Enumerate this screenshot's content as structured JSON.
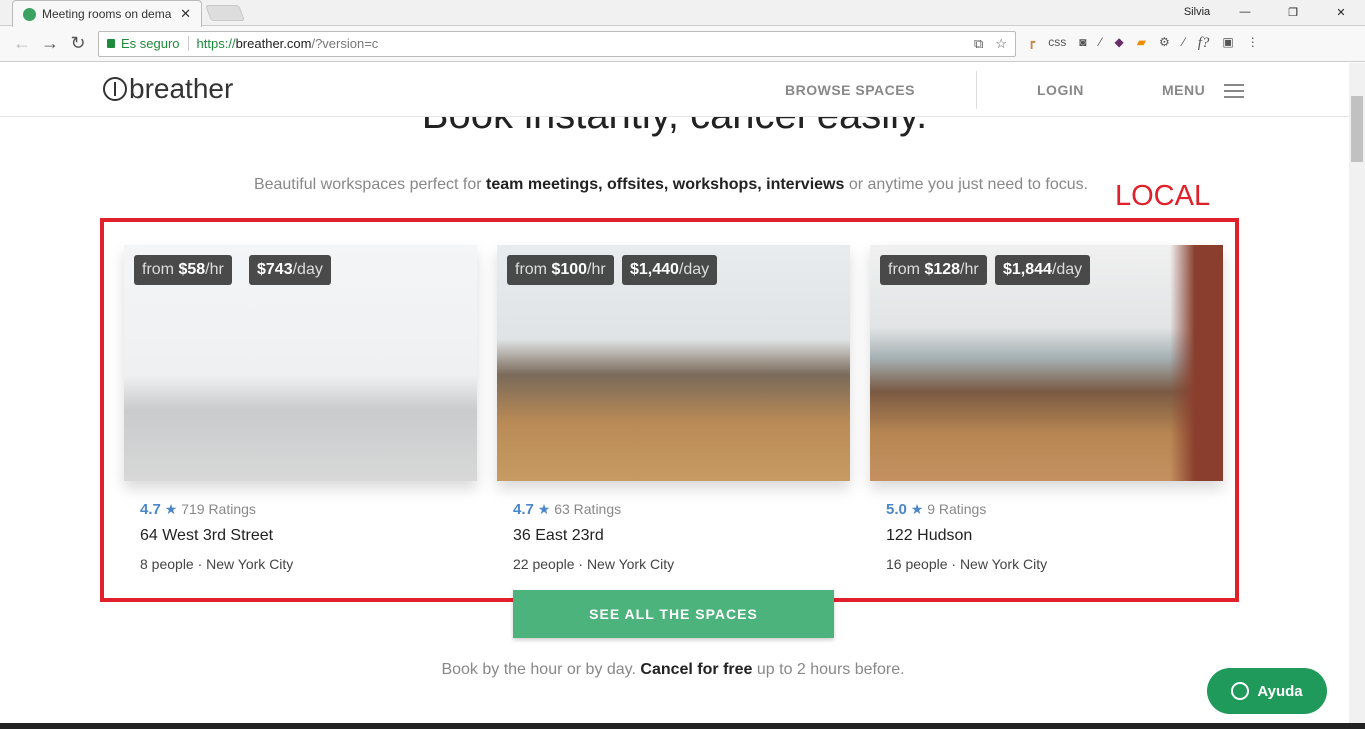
{
  "browser": {
    "tab_title": "Meeting rooms on dema",
    "user": "Silvia",
    "secure_label": "Es seguro",
    "url_scheme": "https://",
    "url_host": "breather.com",
    "url_path": "/?version=c",
    "extensions": [
      "ruler-icon",
      "css",
      "camera-icon",
      "eyedropper-icon",
      "layers-icon",
      "tag-icon",
      "gear-icon",
      "eyedropper-icon",
      "f?",
      "bulb-icon"
    ]
  },
  "header": {
    "logo": "breather",
    "browse": "BROWSE SPACES",
    "login": "LOGIN",
    "menu": "MENU"
  },
  "hero": {
    "title": "Book instantly, cancel easily.",
    "sub_pre": "Beautiful workspaces perfect for ",
    "sub_bold": "team meetings, offsites, workshops, interviews",
    "sub_post": " or anytime you just need to focus."
  },
  "annotation": {
    "label": "LOCAL",
    "color": "#e0202b"
  },
  "cards": [
    {
      "hr_from": "from ",
      "hr_price": "$58",
      "hr_unit": "/hr",
      "day_price": "$743",
      "day_unit": "/day",
      "rating": "4.7",
      "ratings": "719 Ratings",
      "name": "64 West 3rd Street",
      "info": "8 people · New York City"
    },
    {
      "hr_from": "from ",
      "hr_price": "$100",
      "hr_unit": "/hr",
      "day_price": "$1,440",
      "day_unit": "/day",
      "rating": "4.7",
      "ratings": "63 Ratings",
      "name": "36 East 23rd",
      "info": "22 people · New York City"
    },
    {
      "hr_from": "from ",
      "hr_price": "$128",
      "hr_unit": "/hr",
      "day_price": "$1,844",
      "day_unit": "/day",
      "rating": "5.0",
      "ratings": "9 Ratings",
      "name": "122 Hudson",
      "info": "16 people · New York City"
    }
  ],
  "cta": "SEE ALL THE SPACES",
  "footer": {
    "pre": "Book by the hour or by day. ",
    "bold": "Cancel for free",
    "post": " up to 2 hours before."
  },
  "help": "Ayuda",
  "colors": {
    "accent": "#4bb37b",
    "rating": "#4a86c8"
  }
}
